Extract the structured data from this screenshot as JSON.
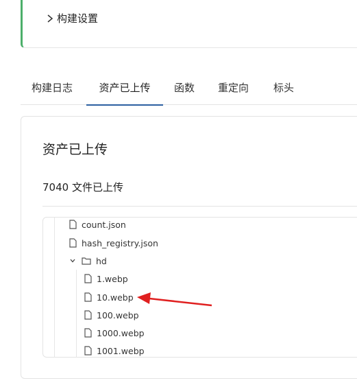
{
  "build_settings": {
    "label": "构建设置"
  },
  "tabs": [
    {
      "label": "构建日志"
    },
    {
      "label": "资产已上传"
    },
    {
      "label": "函数"
    },
    {
      "label": "重定向"
    },
    {
      "label": "标头"
    }
  ],
  "active_tab": "资产已上传",
  "panel": {
    "title": "资产已上传",
    "count_text": "7040 文件已上传"
  },
  "tree": {
    "items": [
      {
        "label": "count.json",
        "type": "file"
      },
      {
        "label": "hash_registry.json",
        "type": "file"
      },
      {
        "label": "hd",
        "type": "folder",
        "expanded": true
      },
      {
        "label": "1.webp",
        "type": "file"
      },
      {
        "label": "10.webp",
        "type": "file"
      },
      {
        "label": "100.webp",
        "type": "file"
      },
      {
        "label": "1000.webp",
        "type": "file"
      },
      {
        "label": "1001.webp",
        "type": "file"
      }
    ]
  },
  "colors": {
    "accent_border": "#4caf6a",
    "active_tab_underline": "#2b5fa0",
    "annotation_arrow": "#e02020"
  }
}
